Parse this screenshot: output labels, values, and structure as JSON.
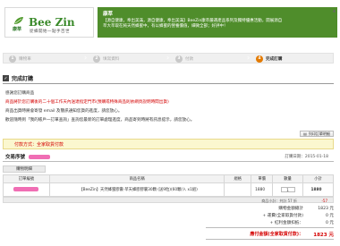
{
  "brand": {
    "cn_name": "康萃",
    "en_name": "Bee Zin",
    "slogan": "從蜂開始一點手百世"
  },
  "banner": {
    "title": "康萃",
    "lines": [
      "【源自健康，奉出美滿，源自健康，奉出美滿】BeeZin康萃嚴選產品系列及獨特優惠活動，開展源自",
      "萃大萃取在純天然蜂蜜中，有以蜂蜜的營養價值，細微全部；好評中！"
    ]
  },
  "steps": [
    {
      "num": "1",
      "label": "購物車"
    },
    {
      "num": "2",
      "label": "填寫資料"
    },
    {
      "num": "3",
      "label": "付款"
    },
    {
      "num": "4",
      "label": "完成訂購"
    }
  ],
  "section_title": "完成訂購",
  "messages": {
    "thanks": "感謝您訂購商品",
    "notice": "商品將於您訂購後的二十個工作天內送達指定門市(預購或特殊商品則依網頁說明時間出貨)",
    "email": "商品出貨時將會寄發 email 及簡訊通知您貨的進度，請您放心。",
    "followup": "歡迎隨時到「我的帳戶一訂單查詢」查詢您最新的訂單處理進度，商品寄到時將有訊息提示，請您放心。"
  },
  "print_button": "列印訂單明細",
  "payment": {
    "label": "付款方式：全家取貨付款"
  },
  "order": {
    "label": "交易序號",
    "time_label": "訂購日期：2015-01-18"
  },
  "list_tab": "購物明細",
  "table": {
    "headers": [
      "訂單編號",
      "商品名稱",
      "規格",
      "單價",
      "數量",
      "小計"
    ],
    "rows": [
      {
        "product": "【BeeZin】天然蜂蜜膠囊-萃天蜂膠膠囊30顆 (送9粒)(60顆/入 x1組)",
        "spec": "",
        "price": "1880",
        "qty": "1",
        "subtotal": "1880"
      }
    ]
  },
  "discount_bar": {
    "label": "商品小計：共計 57 折",
    "value": "-57"
  },
  "totals": [
    {
      "label": "購物金額總計",
      "value": "1823 元"
    },
    {
      "label": "+ 運費(全家取貨付款)",
      "value": "0 元"
    },
    {
      "label": "+ 紅利金額扣抵：",
      "value": "0 元"
    }
  ],
  "final_total": {
    "label": "應付金額(全家取貨付款)：",
    "value": "1823 元"
  },
  "colors": {
    "banner_green": "#4f8d2b",
    "active_step": "#e37a00",
    "alert_red": "#d40000",
    "pay_box_bg": "#fbf7cf"
  }
}
